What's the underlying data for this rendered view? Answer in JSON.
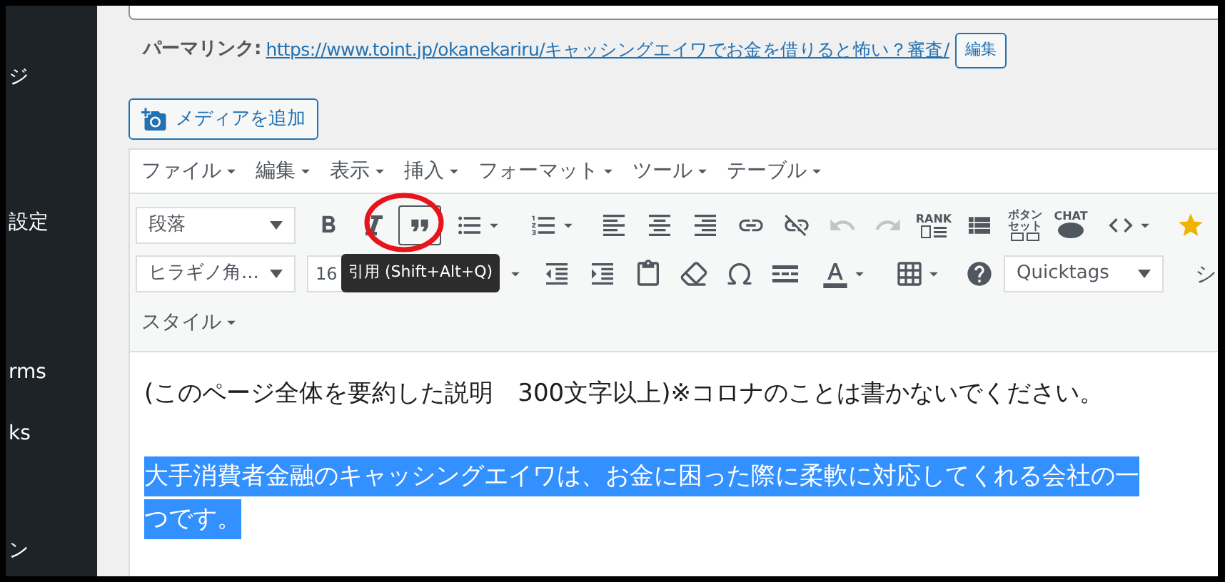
{
  "sidebar": {
    "items": [
      "ジ",
      "設定",
      "rms",
      "ks",
      "ン"
    ]
  },
  "permalink": {
    "label": "パーマリンク:",
    "url": "https://www.toint.jp/okanekariru/キャッシングエイワでお金を借りると怖い？審査/",
    "edit_button": "編集"
  },
  "media_button": "メディアを追加",
  "menubar": [
    "ファイル",
    "編集",
    "表示",
    "挿入",
    "フォーマット",
    "ツール",
    "テーブル"
  ],
  "toolbar_row_1": [
    {
      "kind": "select",
      "value": "段落"
    },
    {
      "kind": "button",
      "active": false,
      "disabled": false
    },
    {
      "kind": "button",
      "active": false,
      "disabled": false
    },
    {
      "kind": "button",
      "active": true,
      "disabled": false
    },
    {
      "kind": "dropdown",
      "active": false,
      "disabled": false
    },
    {
      "kind": "dropdown",
      "active": false,
      "disabled": false
    },
    {
      "kind": "button",
      "active": false,
      "disabled": false
    },
    {
      "kind": "button",
      "active": false,
      "disabled": false
    },
    {
      "kind": "button",
      "active": false,
      "disabled": false
    },
    {
      "kind": "button",
      "active": false,
      "disabled": false
    },
    {
      "kind": "button",
      "active": false,
      "disabled": false
    },
    {
      "kind": "button",
      "active": false,
      "disabled": true
    },
    {
      "kind": "button",
      "active": false,
      "disabled": true
    },
    {
      "kind": "labeled",
      "label": "RANK",
      "active": false,
      "disabled": false
    },
    {
      "kind": "button",
      "active": false,
      "disabled": false
    },
    {
      "kind": "labeled",
      "label": "ボタンセット",
      "active": false,
      "disabled": false
    },
    {
      "kind": "labeled",
      "label": "CHAT",
      "active": false,
      "disabled": false
    },
    {
      "kind": "dropdown",
      "active": false,
      "disabled": false
    },
    {
      "kind": "button",
      "active": false,
      "disabled": false
    }
  ],
  "toolbar_row_2": [
    {
      "kind": "select",
      "value": "ヒラギノ角..."
    },
    {
      "kind": "size",
      "value": "16"
    },
    {
      "kind": "caret"
    },
    {
      "kind": "button",
      "active": false,
      "disabled": false
    },
    {
      "kind": "button",
      "active": false,
      "disabled": false
    },
    {
      "kind": "button",
      "active": false,
      "disabled": false
    },
    {
      "kind": "button",
      "active": false,
      "disabled": false
    },
    {
      "kind": "button",
      "active": false,
      "disabled": false
    },
    {
      "kind": "button",
      "active": false,
      "disabled": false
    },
    {
      "kind": "dropdown",
      "active": false,
      "disabled": false
    },
    {
      "kind": "dropdown",
      "active": false,
      "disabled": false
    },
    {
      "kind": "button",
      "active": false,
      "disabled": false
    },
    {
      "kind": "select",
      "value": "Quicktags"
    },
    {
      "kind": "text",
      "value": "シ"
    }
  ],
  "toolbar_row_3": [
    {
      "kind": "menu",
      "value": "スタイル"
    }
  ],
  "tooltip": "引用 (Shift+Alt+Q)",
  "content": [
    {
      "text": "(このページ全体を要約した説明　300文字以上)※コロナのことは書かないでください。",
      "selected": false
    },
    {
      "text": "大手消費者金融のキャッシングエイワは、お金に困った際に柔軟に対応してくれる会社の一つです。",
      "selected": true
    }
  ]
}
